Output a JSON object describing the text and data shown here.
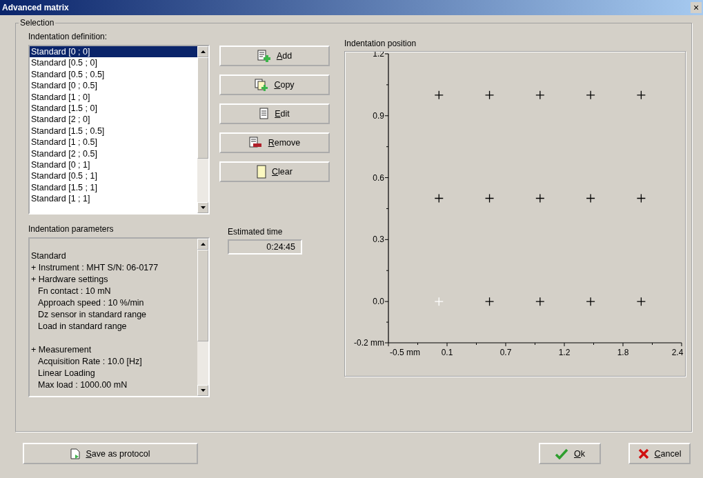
{
  "window": {
    "title": "Advanced matrix",
    "close": "×"
  },
  "selection_group": {
    "title": "Selection"
  },
  "indentation_definition": {
    "label": "Indentation definition:",
    "items": [
      {
        "text": "Standard [0 ; 0]",
        "selected": true
      },
      {
        "text": "Standard [0.5 ; 0]",
        "selected": false
      },
      {
        "text": "Standard [0.5 ; 0.5]",
        "selected": false
      },
      {
        "text": "Standard [0 ; 0.5]",
        "selected": false
      },
      {
        "text": "Standard [1 ; 0]",
        "selected": false
      },
      {
        "text": "Standard [1.5 ; 0]",
        "selected": false
      },
      {
        "text": "Standard [2 ; 0]",
        "selected": false
      },
      {
        "text": "Standard [1.5 ; 0.5]",
        "selected": false
      },
      {
        "text": "Standard [1 ; 0.5]",
        "selected": false
      },
      {
        "text": "Standard [2 ; 0.5]",
        "selected": false
      },
      {
        "text": "Standard [0 ; 1]",
        "selected": false
      },
      {
        "text": "Standard [0.5 ; 1]",
        "selected": false
      },
      {
        "text": "Standard [1.5 ; 1]",
        "selected": false
      },
      {
        "text": "Standard [1 ; 1]",
        "selected": false
      }
    ]
  },
  "action_buttons": [
    {
      "label": "Add",
      "kind": "add"
    },
    {
      "label": "Copy",
      "kind": "copy"
    },
    {
      "label": "Edit",
      "kind": "edit"
    },
    {
      "label": "Remove",
      "kind": "remove"
    },
    {
      "label": "Clear",
      "kind": "clear"
    }
  ],
  "indentation_parameters": {
    "label": "Indentation parameters",
    "lines": [
      {
        "text": "Standard"
      },
      {
        "text": "+ Instrument : MHT S/N: 06-0177"
      },
      {
        "text": "+ Hardware settings",
        "children": [
          {
            "text": "Fn contact : 10 mN"
          },
          {
            "text": "Approach speed : 10 %/min"
          },
          {
            "text": "Dz sensor in standard range"
          },
          {
            "text": "Load in standard range"
          }
        ]
      },
      {
        "text": "+ Measurement",
        "children": [
          {
            "text": "Acquisition Rate : 10.0 [Hz]"
          },
          {
            "text": "Linear Loading"
          },
          {
            "text": "Max load : 1000.00  mN"
          }
        ]
      }
    ]
  },
  "estimated_time": {
    "label": "Estimated time",
    "value": "0:24:45"
  },
  "indentation_position": {
    "label": "Indentation position",
    "chart_data": {
      "type": "scatter",
      "xlim": [
        -0.5,
        2.4
      ],
      "ylim": [
        -0.2,
        1.2
      ],
      "xticks": [
        {
          "value": -0.5,
          "label": "-0.5 mm"
        },
        {
          "value": 0.08,
          "label": "0.1"
        },
        {
          "value": 0.66,
          "label": "0.7"
        },
        {
          "value": 1.24,
          "label": "1.2"
        },
        {
          "value": 1.82,
          "label": "1.8"
        },
        {
          "value": 2.4,
          "label": "2.4"
        }
      ],
      "yticks": [
        {
          "value": -0.2,
          "label": "-0.2 mm"
        },
        {
          "value": 0,
          "label": "0.0"
        },
        {
          "value": 0.3,
          "label": "0.3"
        },
        {
          "value": 0.6,
          "label": "0.6"
        },
        {
          "value": 0.9,
          "label": "0.9"
        },
        {
          "value": 1.2,
          "label": "1.2"
        }
      ],
      "series": [
        {
          "color": "#000000",
          "x": [
            0,
            0.5,
            1,
            1.5,
            2,
            0,
            0.5,
            1,
            1.5,
            2,
            0.5,
            1,
            1.5,
            2
          ],
          "values": [
            1,
            1,
            1,
            1,
            1,
            0.5,
            0.5,
            0.5,
            0.5,
            0.5,
            0,
            0,
            0,
            0
          ]
        },
        {
          "color": "#ffffff",
          "x": [
            0
          ],
          "values": [
            0
          ]
        }
      ]
    }
  },
  "bottom_buttons": [
    {
      "label": "Save as protocol",
      "kind": "save"
    },
    {
      "label": "Ok",
      "kind": "ok"
    },
    {
      "label": "Cancel",
      "kind": "cancel"
    }
  ]
}
